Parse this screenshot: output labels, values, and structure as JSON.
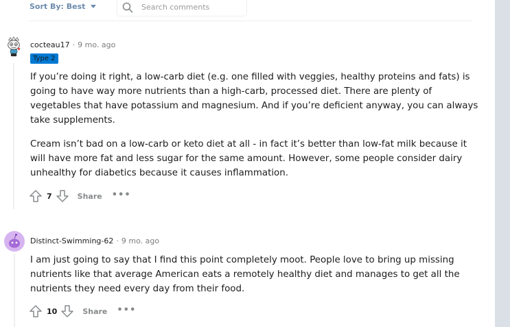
{
  "sort": {
    "label": "Sort By: Best"
  },
  "search": {
    "placeholder": "Search comments"
  },
  "comments": [
    {
      "author": "cocteau17",
      "time": "9 mo. ago",
      "flair": "Type 2",
      "paragraphs": [
        "If you’re doing it right, a low-carb diet (e.g. one filled with veggies, healthy proteins and fats) is going to have way more nutrients than a high-carb, processed diet. There are plenty of vegetables that have potassium and magnesium. And if you’re deficient anyway, you can always take supplements.",
        "Cream isn’t bad on a low-carb or keto diet at all - in fact it’s better than low-fat milk because it will have more fat and less sugar for the same amount. However, some people consider dairy unhealthy for diabetics because it causes inflammation."
      ],
      "votes": "7",
      "share_label": "Share",
      "more_label": "•••"
    },
    {
      "author": "Distinct-Swimming-62",
      "time": "9 mo. ago",
      "paragraphs": [
        "I am just going to say that I find this point completely moot. People love to bring up missing nutrients like that average American eats a remotely healthy diet and manages to get all the nutrients they need every day from their food."
      ],
      "votes": "10",
      "share_label": "Share",
      "more_label": "•••"
    }
  ]
}
